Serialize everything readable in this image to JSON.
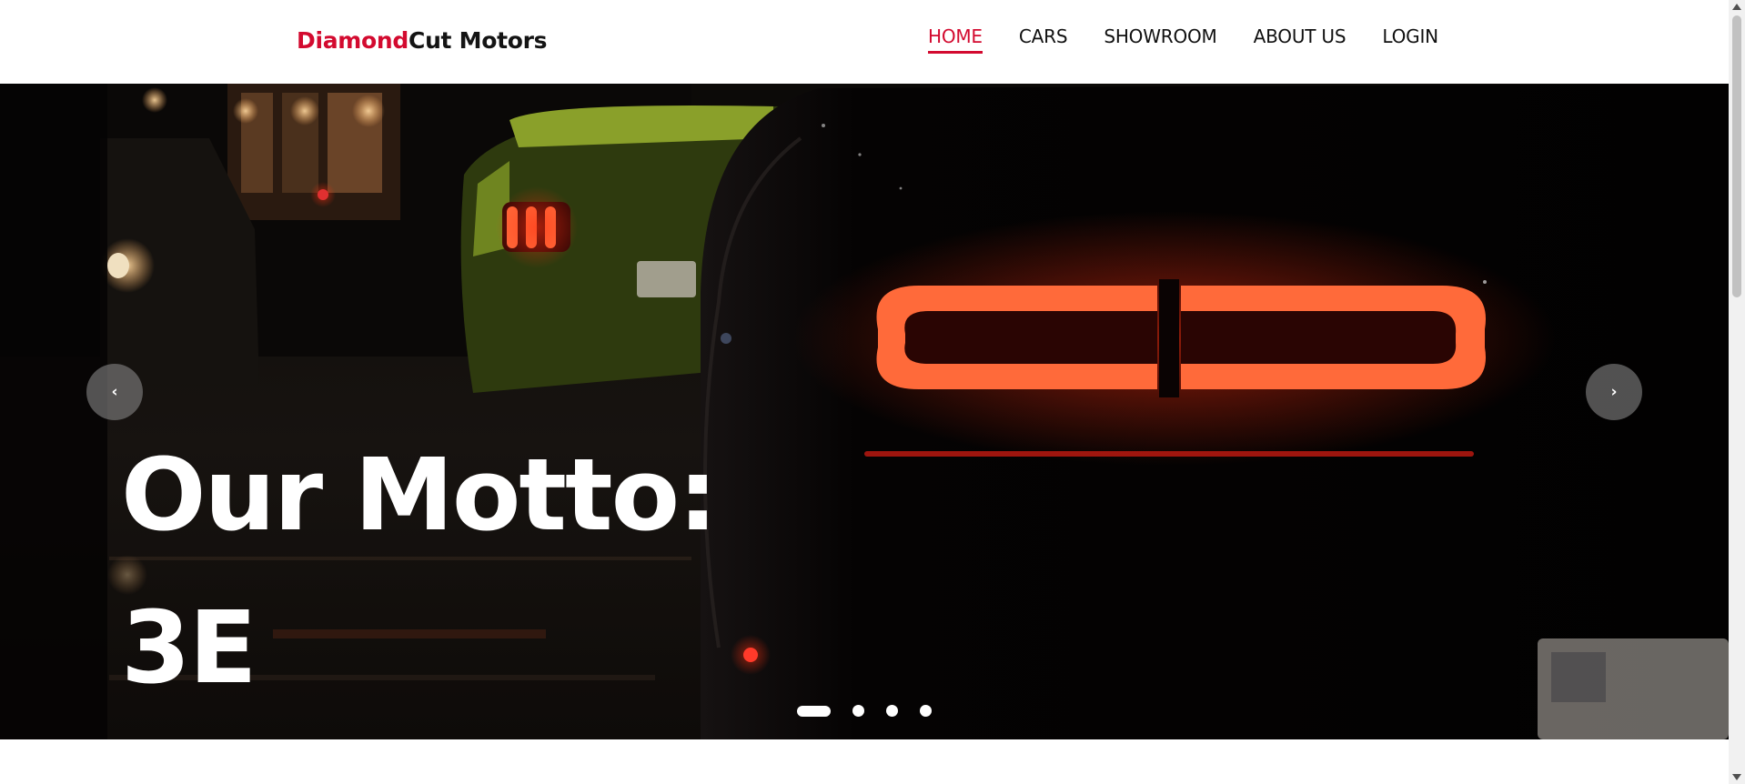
{
  "header": {
    "brand_accent": "Diamond",
    "brand_rest": "Cut Motors",
    "nav": [
      {
        "label": "HOME",
        "active": true
      },
      {
        "label": "CARS",
        "active": false
      },
      {
        "label": "SHOWROOM",
        "active": false
      },
      {
        "label": "ABOUT US",
        "active": false
      },
      {
        "label": "LOGIN",
        "active": false
      }
    ]
  },
  "hero": {
    "headline_line1": "Our Motto:",
    "headline_line2": "3E",
    "prev_icon": "chevron-left-icon",
    "next_icon": "chevron-right-icon",
    "prev_glyph": "‹",
    "next_glyph": "›",
    "slide_count": 4,
    "active_slide": 1
  },
  "colors": {
    "brand_accent": "#d30a2f",
    "text_dark": "#141414",
    "hero_bg": "#050303",
    "taillight": "#ff5a2a"
  }
}
